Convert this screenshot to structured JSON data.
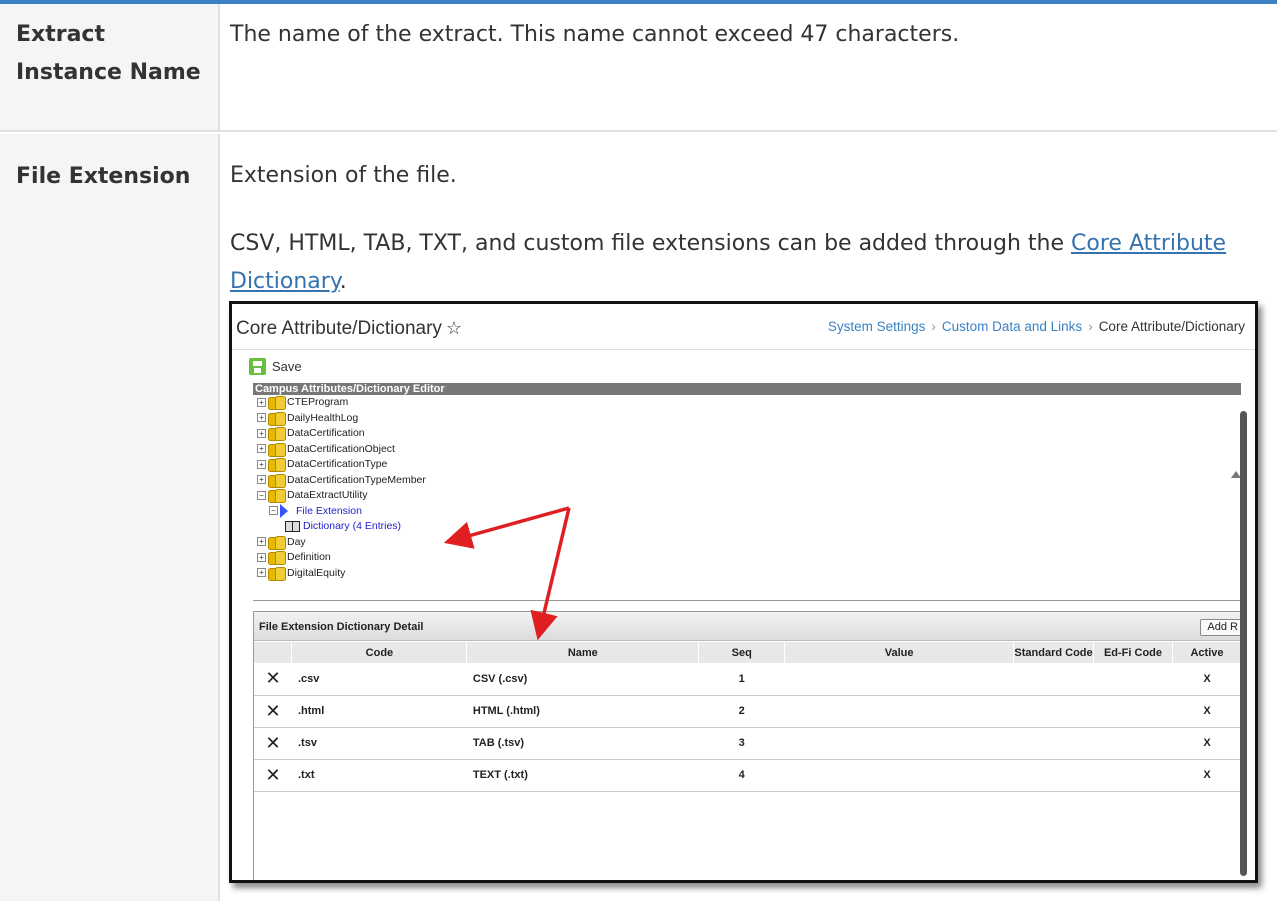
{
  "rows": [
    {
      "label": "Extract Instance Name",
      "description": "The name of the extract. This name cannot exceed 47 characters."
    },
    {
      "label": "File Extension",
      "description": "Extension of the file.",
      "description2_prefix": "CSV, HTML, TAB, TXT, and custom file extensions can be added through the ",
      "link_text": "Core Attribute Dictionary",
      "description2_suffix": "."
    }
  ],
  "screenshot": {
    "page_title": "Core Attribute/Dictionary",
    "breadcrumb": [
      "System Settings",
      "Custom Data and Links",
      "Core Attribute/Dictionary"
    ],
    "save_label": "Save",
    "editor_title": "Campus Attributes/Dictionary Editor",
    "tree": [
      "CTEProgram",
      "DailyHealthLog",
      "DataCertification",
      "DataCertificationObject",
      "DataCertificationType",
      "DataCertificationTypeMember",
      "DataExtractUtility",
      "File Extension",
      "Dictionary (4 Entries)",
      "Day",
      "Definition",
      "DigitalEquity"
    ],
    "detail_title": "File Extension Dictionary Detail",
    "add_button": "Add R",
    "columns": [
      "Code",
      "Name",
      "Seq",
      "Value",
      "Standard Code",
      "Ed-Fi Code",
      "Active"
    ],
    "entries": [
      {
        "code": ".csv",
        "name": "CSV (.csv)",
        "seq": "1",
        "value": "",
        "standard_code": "",
        "edfi_code": "",
        "active": "X"
      },
      {
        "code": ".html",
        "name": "HTML (.html)",
        "seq": "2",
        "value": "",
        "standard_code": "",
        "edfi_code": "",
        "active": "X"
      },
      {
        "code": ".tsv",
        "name": "TAB (.tsv)",
        "seq": "3",
        "value": "",
        "standard_code": "",
        "edfi_code": "",
        "active": "X"
      },
      {
        "code": ".txt",
        "name": "TEXT (.txt)",
        "seq": "4",
        "value": "",
        "standard_code": "",
        "edfi_code": "",
        "active": "X"
      }
    ],
    "delete_glyph": "✕",
    "annotation_color": "#e02020"
  }
}
